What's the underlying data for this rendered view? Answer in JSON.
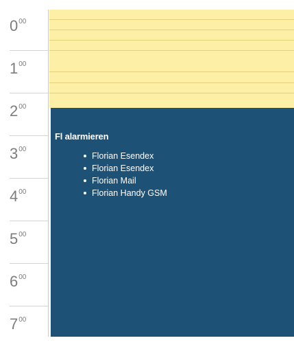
{
  "calendar": {
    "hours": [
      {
        "hour": "0",
        "minutes": "00"
      },
      {
        "hour": "1",
        "minutes": "00"
      },
      {
        "hour": "2",
        "minutes": "00"
      },
      {
        "hour": "3",
        "minutes": "00"
      },
      {
        "hour": "4",
        "minutes": "00"
      },
      {
        "hour": "5",
        "minutes": "00"
      },
      {
        "hour": "6",
        "minutes": "00"
      },
      {
        "hour": "7",
        "minutes": "00"
      }
    ],
    "appointment": {
      "title": "Fl alarmieren",
      "targets": [
        "Florian Esendex",
        "Florian Esendex",
        "Florian Mail",
        "Florian Handy GSM"
      ]
    },
    "colors": {
      "free_slot": "#fdf0a6",
      "appointment": "#1e5176",
      "hour_text": "#7d7d7d"
    }
  }
}
